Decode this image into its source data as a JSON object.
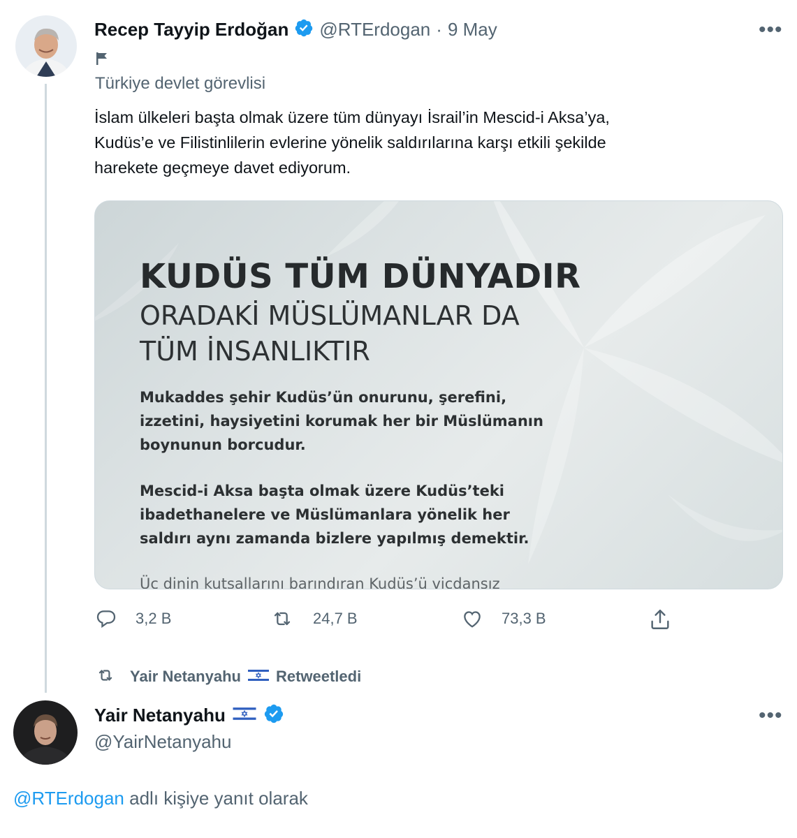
{
  "tweet1": {
    "author_name": "Recep Tayyip Erdoğan",
    "author_handle": "@RTErdogan",
    "separator": "·",
    "date": "9 May",
    "label_icon": "flag-icon",
    "label_text": "Türkiye devlet görevlisi",
    "text_lines": [
      "İslam ülkeleri başta olmak üzere tüm dünyayı İsrail’in Mescid-i Aksa’ya,",
      "Kudüs’e ve Filistinlilerin evlerine yönelik saldırılarına karşı etkili şekilde",
      "harekete geçmeye davet ediyorum."
    ],
    "media": {
      "title": "KUDÜS TÜM DÜNYADIR",
      "subtitle_lines": [
        "ORADAKİ MÜSLÜMANLAR DA",
        "TÜM İNSANLIKTIR"
      ],
      "paragraph1": [
        "Mukaddes şehir Kudüs’ün onurunu, şerefini,",
        "izzetini, haysiyetini korumak her bir Müslümanın",
        "boynunun borcudur."
      ],
      "paragraph2": [
        "Mescid-i Aksa başta olmak üzere Kudüs’teki",
        "ibadethanelere ve Müslümanlara yönelik her",
        "saldırı aynı zamanda bizlere yapılmış demektir."
      ],
      "cut_line": "Üç dinin kutsallarını barındıran Kudüs’ü vicdansız"
    },
    "actions": {
      "replies": "3,2 B",
      "retweets": "24,7 B",
      "likes": "73,3 B"
    }
  },
  "retweet_banner": {
    "name": "Yair Netanyahu",
    "flag": "🇮🇱",
    "suffix": "Retweetledi"
  },
  "tweet2": {
    "author_name": "Yair Netanyahu",
    "flag": "🇮🇱",
    "author_handle": "@YairNetanyahu",
    "reply_handle": "@RTErdogan",
    "reply_suffix": "adlı kişiye yanıt olarak"
  },
  "colors": {
    "verified": "#1d9bf0",
    "muted": "#536471",
    "link": "#1d9bf0"
  }
}
